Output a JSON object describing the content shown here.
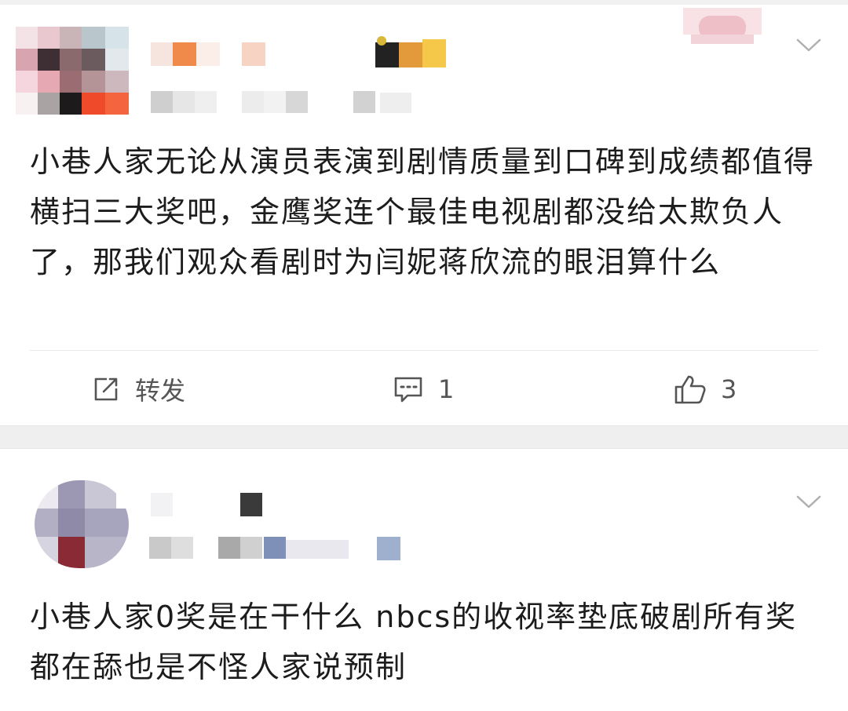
{
  "feed": {
    "posts": [
      {
        "content": "小巷人家无论从演员表演到剧情质量到口碑到成绩都值得横扫三大奖吧，金鹰奖连个最佳电视剧都没给太欺负人了，那我们观众看剧时为闫妮蒋欣流的眼泪算什么",
        "actions": {
          "repost_label": "转发",
          "comment_count": "1",
          "like_count": "3"
        }
      },
      {
        "content": "小巷人家0奖是在干什么 nbcs的收视率垫底破剧所有奖都在舔也是不怪人家说预制"
      }
    ]
  },
  "icons": {
    "menu": "chevron-down-icon",
    "repost": "share-edit-icon",
    "comment": "comment-bubble-icon",
    "like": "thumbs-up-icon"
  },
  "colors": {
    "divider": "#e9e9e9",
    "separator_band": "#efefef",
    "action_text": "#555555"
  }
}
